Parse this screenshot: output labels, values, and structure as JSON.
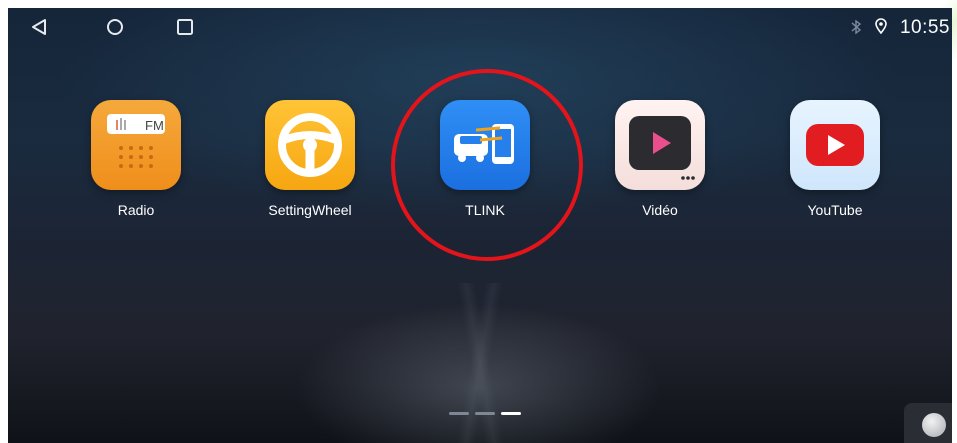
{
  "statusbar": {
    "nav": [
      {
        "name": "back",
        "icon": "back-triangle-icon"
      },
      {
        "name": "home",
        "icon": "home-circle-icon"
      },
      {
        "name": "recents",
        "icon": "recents-square-icon"
      }
    ],
    "bluetooth_icon": "bluetooth-icon",
    "location_icon": "location-icon",
    "time": "10:55"
  },
  "apps": [
    {
      "label": "Radio",
      "icon": "radio-icon",
      "icon_text": "FM",
      "color": "#f19a2a"
    },
    {
      "label": "SettingWheel",
      "icon": "steering-wheel-icon",
      "color": "#fbb524"
    },
    {
      "label": "TLINK",
      "icon": "car-phone-link-icon",
      "color": "#2680ec"
    },
    {
      "label": "Vidéo",
      "icon": "video-play-icon",
      "color": "#e94f8d"
    },
    {
      "label": "YouTube",
      "icon": "youtube-icon",
      "color": "#e21d22"
    }
  ],
  "highlight": {
    "target": "TLINK",
    "color": "#e5141b"
  },
  "pager": {
    "pages": 3,
    "active": 3
  },
  "assistive_touch_icon": "assistive-touch-icon"
}
